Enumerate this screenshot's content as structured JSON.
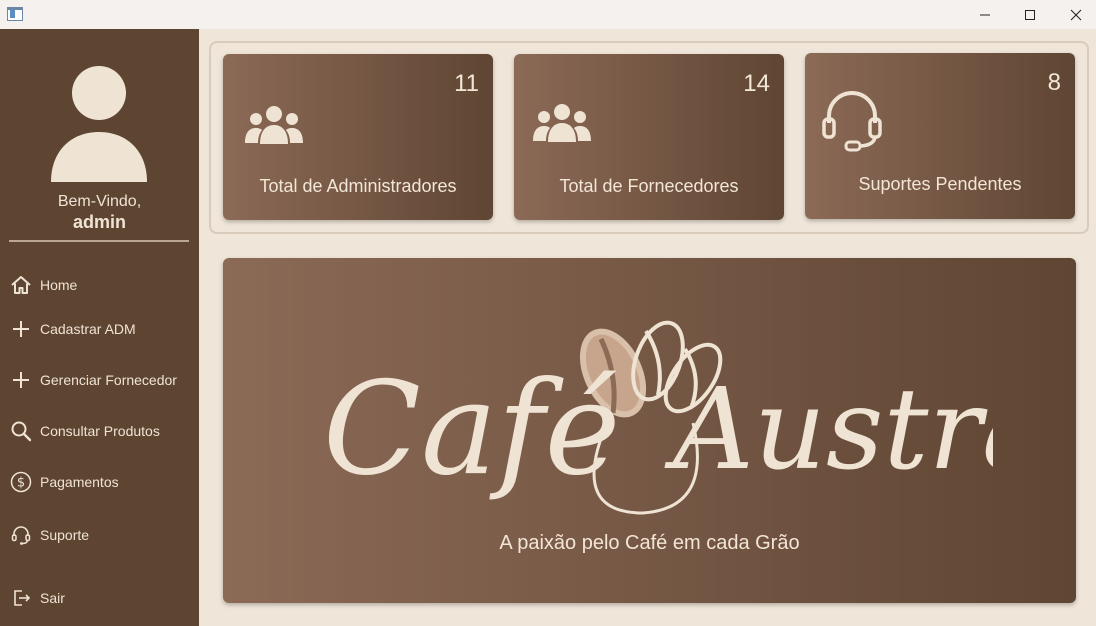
{
  "window": {
    "minimize_icon": "minimize-icon",
    "maximize_icon": "maximize-icon",
    "close_icon": "close-icon"
  },
  "sidebar": {
    "welcome": "Bem-Vindo,",
    "username": "admin",
    "items": [
      {
        "label": "Home",
        "icon": "home-icon"
      },
      {
        "label": "Cadastrar ADM",
        "icon": "plus-icon"
      },
      {
        "label": "Gerenciar Fornecedor",
        "icon": "plus-icon"
      },
      {
        "label": "Consultar Produtos",
        "icon": "search-icon"
      },
      {
        "label": "Pagamentos",
        "icon": "dollar-circle-icon"
      },
      {
        "label": "Suporte",
        "icon": "headset-icon"
      },
      {
        "label": "Sair",
        "icon": "logout-icon"
      }
    ]
  },
  "cards": [
    {
      "count": "11",
      "label": "Total de Administradores",
      "icon": "users-group-icon"
    },
    {
      "count": "14",
      "label": "Total de Fornecedores",
      "icon": "users-group-icon"
    },
    {
      "count": "8",
      "label": "Suportes Pendentes",
      "icon": "headset-icon"
    }
  ],
  "banner": {
    "logo_text": "Café Austral",
    "tagline": "A paixão pelo Café em cada Grão"
  },
  "colors": {
    "sidebar_bg": "#5e4531",
    "page_bg": "#efe5d8",
    "card_gradient_start": "#8b6a56",
    "card_gradient_end": "#5f4533",
    "text_light": "#efe3d4"
  }
}
